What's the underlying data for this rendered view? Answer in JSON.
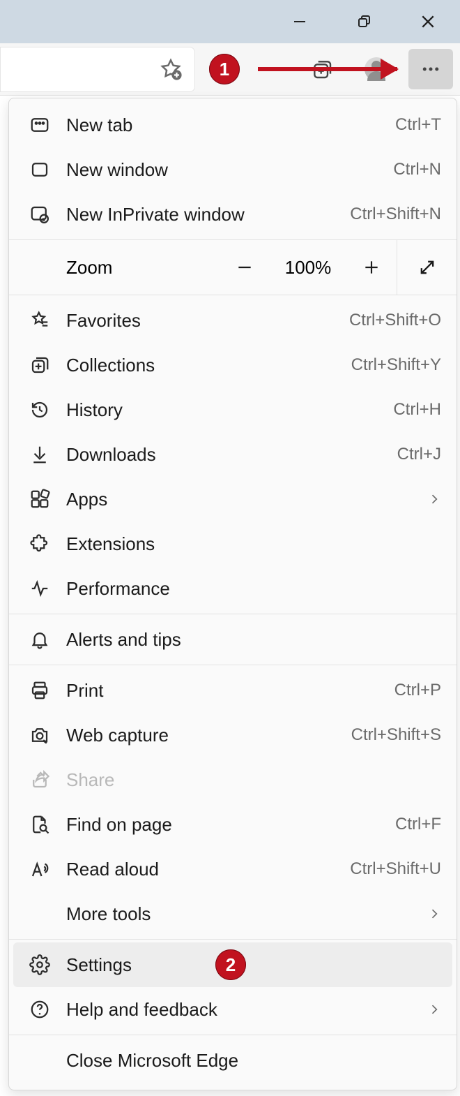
{
  "annotations": {
    "step1": "1",
    "step2": "2"
  },
  "zoom": {
    "label": "Zoom",
    "value": "100%"
  },
  "menu": {
    "new_tab": {
      "label": "New tab",
      "shortcut": "Ctrl+T"
    },
    "new_window": {
      "label": "New window",
      "shortcut": "Ctrl+N"
    },
    "inprivate": {
      "label": "New InPrivate window",
      "shortcut": "Ctrl+Shift+N"
    },
    "favorites": {
      "label": "Favorites",
      "shortcut": "Ctrl+Shift+O"
    },
    "collections": {
      "label": "Collections",
      "shortcut": "Ctrl+Shift+Y"
    },
    "history": {
      "label": "History",
      "shortcut": "Ctrl+H"
    },
    "downloads": {
      "label": "Downloads",
      "shortcut": "Ctrl+J"
    },
    "apps": {
      "label": "Apps"
    },
    "extensions": {
      "label": "Extensions"
    },
    "performance": {
      "label": "Performance"
    },
    "alerts": {
      "label": "Alerts and tips"
    },
    "print": {
      "label": "Print",
      "shortcut": "Ctrl+P"
    },
    "web_capture": {
      "label": "Web capture",
      "shortcut": "Ctrl+Shift+S"
    },
    "share": {
      "label": "Share"
    },
    "find": {
      "label": "Find on page",
      "shortcut": "Ctrl+F"
    },
    "read_aloud": {
      "label": "Read aloud",
      "shortcut": "Ctrl+Shift+U"
    },
    "more_tools": {
      "label": "More tools"
    },
    "settings": {
      "label": "Settings"
    },
    "help": {
      "label": "Help and feedback"
    },
    "close": {
      "label": "Close Microsoft Edge"
    }
  }
}
